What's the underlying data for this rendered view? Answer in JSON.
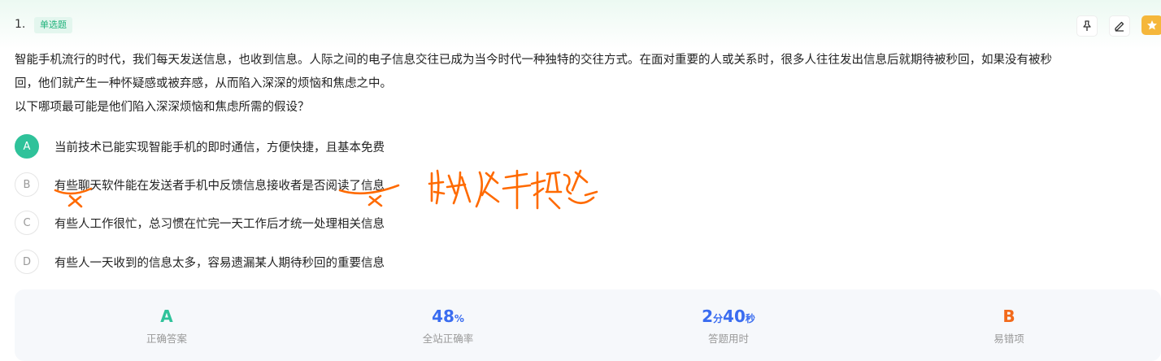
{
  "question": {
    "number": "1.",
    "type_tag": "单选题",
    "stem_lines": [
      "智能手机流行的时代，我们每天发送信息，也收到信息。人际之间的电子信息交往已成为当今时代一种独特的交往方式。在面对重要的人或关系时，很多人往往发出信息后就期待被秒回，如果没有被秒",
      "回，他们就产生一种怀疑感或被弃感，从而陷入深深的烦恼和焦虑之中。",
      "以下哪项最可能是他们陷入深深烦恼和焦虑所需的假设？"
    ],
    "options": [
      {
        "letter": "A",
        "text": "当前技术已能实现智能手机的即时通信，方便快捷，且基本免费"
      },
      {
        "letter": "B",
        "text": "有些聊天软件能在发送者手机中反馈信息接收者是否阅读了信息"
      },
      {
        "letter": "C",
        "text": "有些人工作很忙，总习惯在忙完一天工作后才统一处理相关信息"
      },
      {
        "letter": "D",
        "text": "有些人一天收到的信息太多，容易遗漏某人期待秒回的重要信息"
      }
    ]
  },
  "stats": {
    "correct_answer": {
      "value": "A",
      "label": "正确答案",
      "color": "#2fc29a"
    },
    "accuracy": {
      "value": "48",
      "unit": "%",
      "label": "全站正确率",
      "color": "#3a6cf0"
    },
    "time_used": {
      "min": "2",
      "min_unit": "分",
      "sec": "40",
      "sec_unit": "秒",
      "label": "答题用时",
      "color": "#3a6cf0"
    },
    "common_wrong": {
      "value": "B",
      "label": "易错项",
      "color": "#f26a1b"
    }
  },
  "colors": {
    "accent_green": "#2fc29a",
    "ink_orange": "#ff6a00",
    "star_yellow": "#f5b73b"
  },
  "icons": [
    "pin-icon",
    "edit-icon",
    "star-icon"
  ]
}
